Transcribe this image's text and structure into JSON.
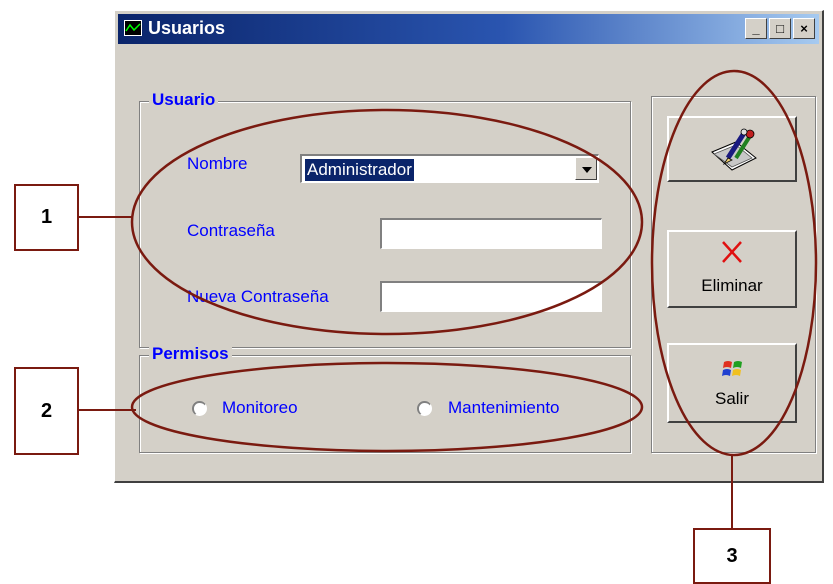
{
  "window": {
    "title": "Usuarios",
    "buttons": [
      "_",
      "□",
      "×"
    ]
  },
  "usuario_group": {
    "legend": "Usuario",
    "nombre_label": "Nombre",
    "nombre_value": "Administrador",
    "contrasena_label": "Contraseña",
    "contrasena_value": "",
    "nueva_label": "Nueva Contraseña",
    "nueva_value": ""
  },
  "permisos_group": {
    "legend": "Permisos",
    "options": [
      {
        "label": "Monitoreo",
        "selected": false
      },
      {
        "label": "Mantenimiento",
        "selected": false
      }
    ]
  },
  "buttons": {
    "edit": {
      "label": "",
      "icon": "edit-pencil-icon"
    },
    "delete": {
      "label": "Eliminar",
      "icon": "red-x-icon"
    },
    "exit": {
      "label": "Salir",
      "icon": "windows-flag-icon"
    }
  },
  "callouts": [
    "1",
    "2",
    "3"
  ],
  "colors": {
    "accent_blue": "#0000ff",
    "title_bar": "#0a246a",
    "annotation": "#7a1a10"
  }
}
